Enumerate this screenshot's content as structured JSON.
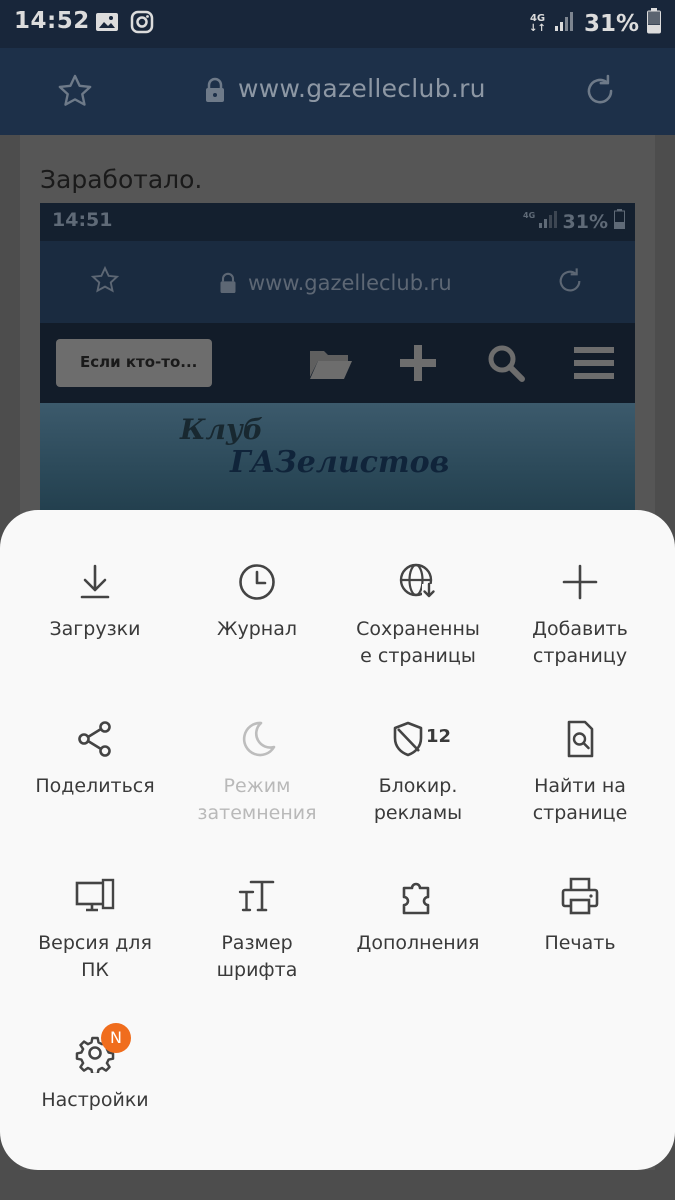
{
  "status_bar": {
    "time": "14:52",
    "network": "4G",
    "battery": "31%"
  },
  "browser": {
    "url": "www.gazelleclub.ru"
  },
  "page": {
    "post_text": "Заработало.",
    "screenshot": {
      "time": "14:51",
      "battery": "31%",
      "url": "www.gazelleclub.ru",
      "back_label": "Если кто-то...",
      "banner_line1": "Клуб",
      "banner_line2": "ГАЗелистов"
    }
  },
  "menu": {
    "items": [
      {
        "label": "Загрузки",
        "icon": "download-icon"
      },
      {
        "label": "Журнал",
        "icon": "history-icon"
      },
      {
        "label": "Сохраненны\nе страницы",
        "icon": "saved-pages-icon"
      },
      {
        "label": "Добавить\nстраницу",
        "icon": "add-icon"
      },
      {
        "label": "Поделиться",
        "icon": "share-icon"
      },
      {
        "label": "Режим\nзатемнения",
        "icon": "moon-icon"
      },
      {
        "label": "Блокир.\nрекламы",
        "icon": "shield-icon",
        "count": "12"
      },
      {
        "label": "Найти на\nстранице",
        "icon": "find-in-page-icon"
      },
      {
        "label": "Версия для\nПК",
        "icon": "desktop-icon"
      },
      {
        "label": "Размер\nшрифта",
        "icon": "font-size-icon"
      },
      {
        "label": "Дополнения",
        "icon": "puzzle-icon"
      },
      {
        "label": "Печать",
        "icon": "print-icon"
      },
      {
        "label": "Настройки",
        "icon": "gear-icon",
        "badge": "N"
      }
    ]
  },
  "colors": {
    "toolbar": "#1d3049",
    "sheet": "#f9f9f9",
    "badge": "#f06d1d"
  }
}
